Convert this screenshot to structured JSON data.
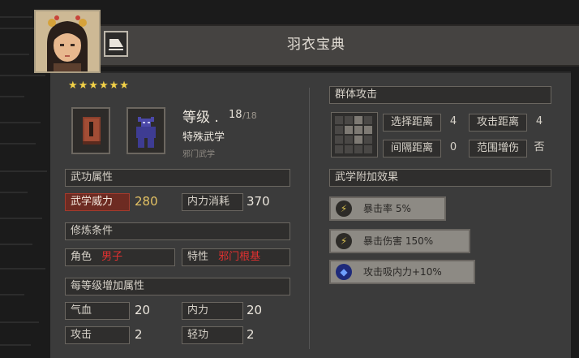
{
  "header": {
    "title": "羽衣宝典"
  },
  "skill": {
    "stars": "★★★★★★",
    "level_label": "等级 .",
    "level_value": "18",
    "level_max": "/18",
    "type": "特殊武学",
    "subtype": "邪门武学"
  },
  "sections": {
    "attributes": "武功属性",
    "requirements": "修炼条件",
    "per_level": "每等级增加属性",
    "group_attack": "群体攻击",
    "extra_effects": "武学附加效果"
  },
  "attributes": {
    "power_label": "武学威力",
    "power_value": "280",
    "mp_cost_label": "内力消耗",
    "mp_cost_value": "370"
  },
  "requirements": {
    "role_label": "角色",
    "role_value": "男子",
    "trait_label": "特性",
    "trait_value": "邪门根基"
  },
  "per_level": {
    "hp_label": "气血",
    "hp_value": "20",
    "mp_label": "内力",
    "mp_value": "20",
    "atk_label": "攻击",
    "atk_value": "2",
    "agility_label": "轻功",
    "agility_value": "2"
  },
  "group_attack": {
    "select_range_label": "选择距离",
    "select_range_value": "4",
    "attack_range_label": "攻击距离",
    "attack_range_value": "4",
    "interval_label": "间隔距离",
    "interval_value": "0",
    "aoe_bonus_label": "范围增伤",
    "aoe_bonus_value": "否"
  },
  "effects": [
    {
      "label": "暴击率 5%",
      "icon": "lightning-icon"
    },
    {
      "label": "暴击伤害 150%",
      "icon": "lightning-icon"
    },
    {
      "label": "攻击吸内力+10%",
      "icon": "blue-orb-icon"
    }
  ],
  "colors": {
    "accent_gold": "#e4c264",
    "highlight_red": "#6d2b22",
    "warn_text": "#e03030"
  }
}
